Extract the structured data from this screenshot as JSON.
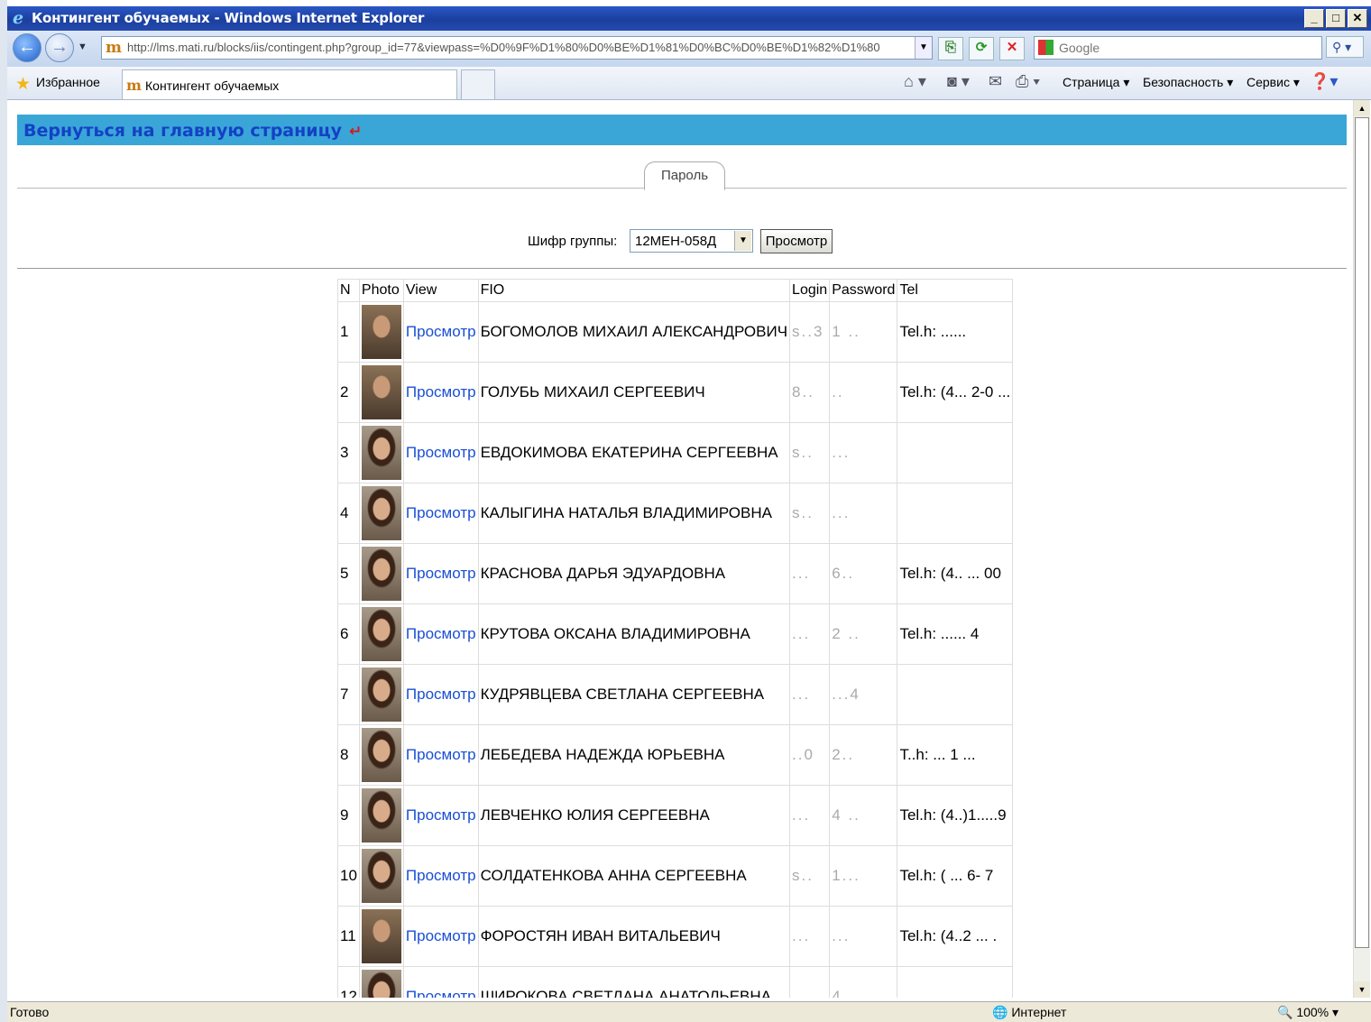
{
  "window": {
    "title": "Контингент обучаемых - Windows Internet Explorer"
  },
  "address": {
    "url": "http://lms.mati.ru/blocks/iis/contingent.php?group_id=77&viewpass=%D0%9F%D1%80%D0%BE%D1%81%D0%BC%D0%BE%D1%82%D1%80"
  },
  "search": {
    "placeholder": "Google"
  },
  "favorites": {
    "label": "Избранное"
  },
  "tab": {
    "title": "Контингент обучаемых"
  },
  "commands": {
    "page": "Страница",
    "safety": "Безопасность",
    "tools": "Сервис"
  },
  "page": {
    "back_link": "Вернуться на главную страницу",
    "password_tab": "Пароль",
    "group_label": "Шифр группы:",
    "group_value": "12МЕН-058Д",
    "view_button": "Просмотр"
  },
  "table": {
    "headers": [
      "N",
      "Photo",
      "View",
      "FIO",
      "Login",
      "Password",
      "Tel"
    ],
    "view_label": "Просмотр",
    "rows": [
      {
        "n": "1",
        "fio": "БОГОМОЛОВ МИХАИЛ АЛЕКСАНДРОВИЧ",
        "login": "s..3",
        "pass": "1 ..",
        "tel": "Tel.h: ......"
      },
      {
        "n": "2",
        "fio": "ГОЛУБЬ МИХАИЛ СЕРГЕЕВИЧ",
        "login": "8..",
        "pass": "..",
        "tel": "Tel.h: (4... 2-0 ..."
      },
      {
        "n": "3",
        "fio": "ЕВДОКИМОВА ЕКАТЕРИНА СЕРГЕЕВНА",
        "login": "s..",
        "pass": "...",
        "tel": ""
      },
      {
        "n": "4",
        "fio": "КАЛЫГИНА НАТАЛЬЯ ВЛАДИМИРОВНА",
        "login": "s..",
        "pass": "...",
        "tel": ""
      },
      {
        "n": "5",
        "fio": "КРАСНОВА ДАРЬЯ ЭДУАРДОВНА",
        "login": "...",
        "pass": "6..",
        "tel": "Tel.h: (4.. ... 00"
      },
      {
        "n": "6",
        "fio": "КРУТОВА ОКСАНА ВЛАДИМИРОВНА",
        "login": "...",
        "pass": "2 ..",
        "tel": "Tel.h: ...... 4"
      },
      {
        "n": "7",
        "fio": "КУДРЯВЦЕВА СВЕТЛАНА СЕРГЕЕВНА",
        "login": "...",
        "pass": "...4",
        "tel": ""
      },
      {
        "n": "8",
        "fio": "ЛЕБЕДЕВА НАДЕЖДА ЮРЬЕВНА",
        "login": "..0",
        "pass": "2..",
        "tel": "T..h: ... 1 ..."
      },
      {
        "n": "9",
        "fio": "ЛЕВЧЕНКО ЮЛИЯ СЕРГЕЕВНА",
        "login": "...",
        "pass": "4 ..",
        "tel": "Tel.h: (4..)1.....9"
      },
      {
        "n": "10",
        "fio": "СОЛДАТЕНКОВА АННА СЕРГЕЕВНА",
        "login": "s..",
        "pass": "1...",
        "tel": "Tel.h: ( ... 6- 7"
      },
      {
        "n": "11",
        "fio": "ФОРОСТЯН ИВАН ВИТАЛЬЕВИЧ",
        "login": "...",
        "pass": "...",
        "tel": "Tel.h: (4..2 ... ."
      },
      {
        "n": "12",
        "fio": "ШИРОКОВА СВЕТЛАНА АНАТОЛЬЕВНА",
        "login": "...",
        "pass": "4..",
        "tel": ""
      }
    ]
  },
  "status": {
    "left": "Готово",
    "zone": "Интернет",
    "zoom": "100%"
  }
}
